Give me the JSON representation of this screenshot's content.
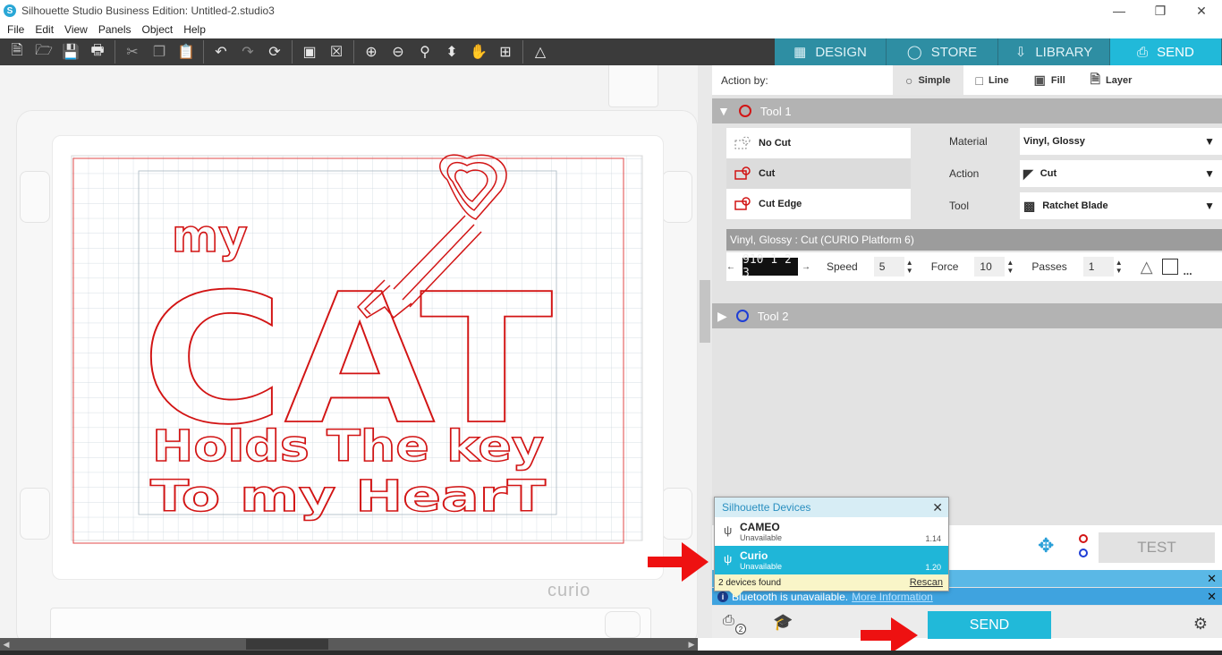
{
  "window": {
    "title": "Silhouette Studio Business Edition: Untitled-2.studio3",
    "minimize": "—",
    "restore": "❐",
    "close": "✕"
  },
  "menu": [
    "File",
    "Edit",
    "View",
    "Panels",
    "Object",
    "Help"
  ],
  "nav_tabs": [
    {
      "label": "DESIGN",
      "icon": "grid-icon"
    },
    {
      "label": "STORE",
      "icon": "store-icon"
    },
    {
      "label": "LIBRARY",
      "icon": "library-icon"
    },
    {
      "label": "SEND",
      "icon": "send-icon"
    }
  ],
  "canvas": {
    "design_lines": [
      "my",
      "CAT",
      "Holds The key",
      "To my HearT"
    ],
    "mat_brand": "curio"
  },
  "panel": {
    "action_by": {
      "label": "Action by:",
      "options": [
        "Simple",
        "Line",
        "Fill",
        "Layer"
      ]
    },
    "tool1": {
      "label": "Tool 1",
      "cut_options": [
        "No Cut",
        "Cut",
        "Cut Edge"
      ],
      "material_label": "Material",
      "material_value": "Vinyl, Glossy",
      "action_label": "Action",
      "action_value": "Cut",
      "tool_label": "Tool",
      "tool_value": "Ratchet Blade",
      "mat_info": "Vinyl, Glossy : Cut (CURIO Platform 6)",
      "blade_display": "910 1 2 3",
      "speed_label": "Speed",
      "speed_value": "5",
      "force_label": "Force",
      "force_value": "10",
      "passes_label": "Passes",
      "passes_value": "1",
      "more": "..."
    },
    "tool2": {
      "label": "Tool 2"
    },
    "test_label": "TEST",
    "notif_bluetooth": "Bluetooth is unavailable.",
    "notif_more": "More Information",
    "send_label": "SEND",
    "devices_badge": "2"
  },
  "devices_popup": {
    "title": "Silhouette Devices",
    "devices": [
      {
        "name": "CAMEO",
        "status": "Unavailable",
        "version": "1.14"
      },
      {
        "name": "Curio",
        "status": "Unavailable",
        "version": "1.20"
      }
    ],
    "found": "2 devices found",
    "rescan": "Rescan"
  },
  "colors": {
    "accent": "#21b9d9",
    "design_red": "#d21414",
    "arrow_red": "#ee1111"
  }
}
